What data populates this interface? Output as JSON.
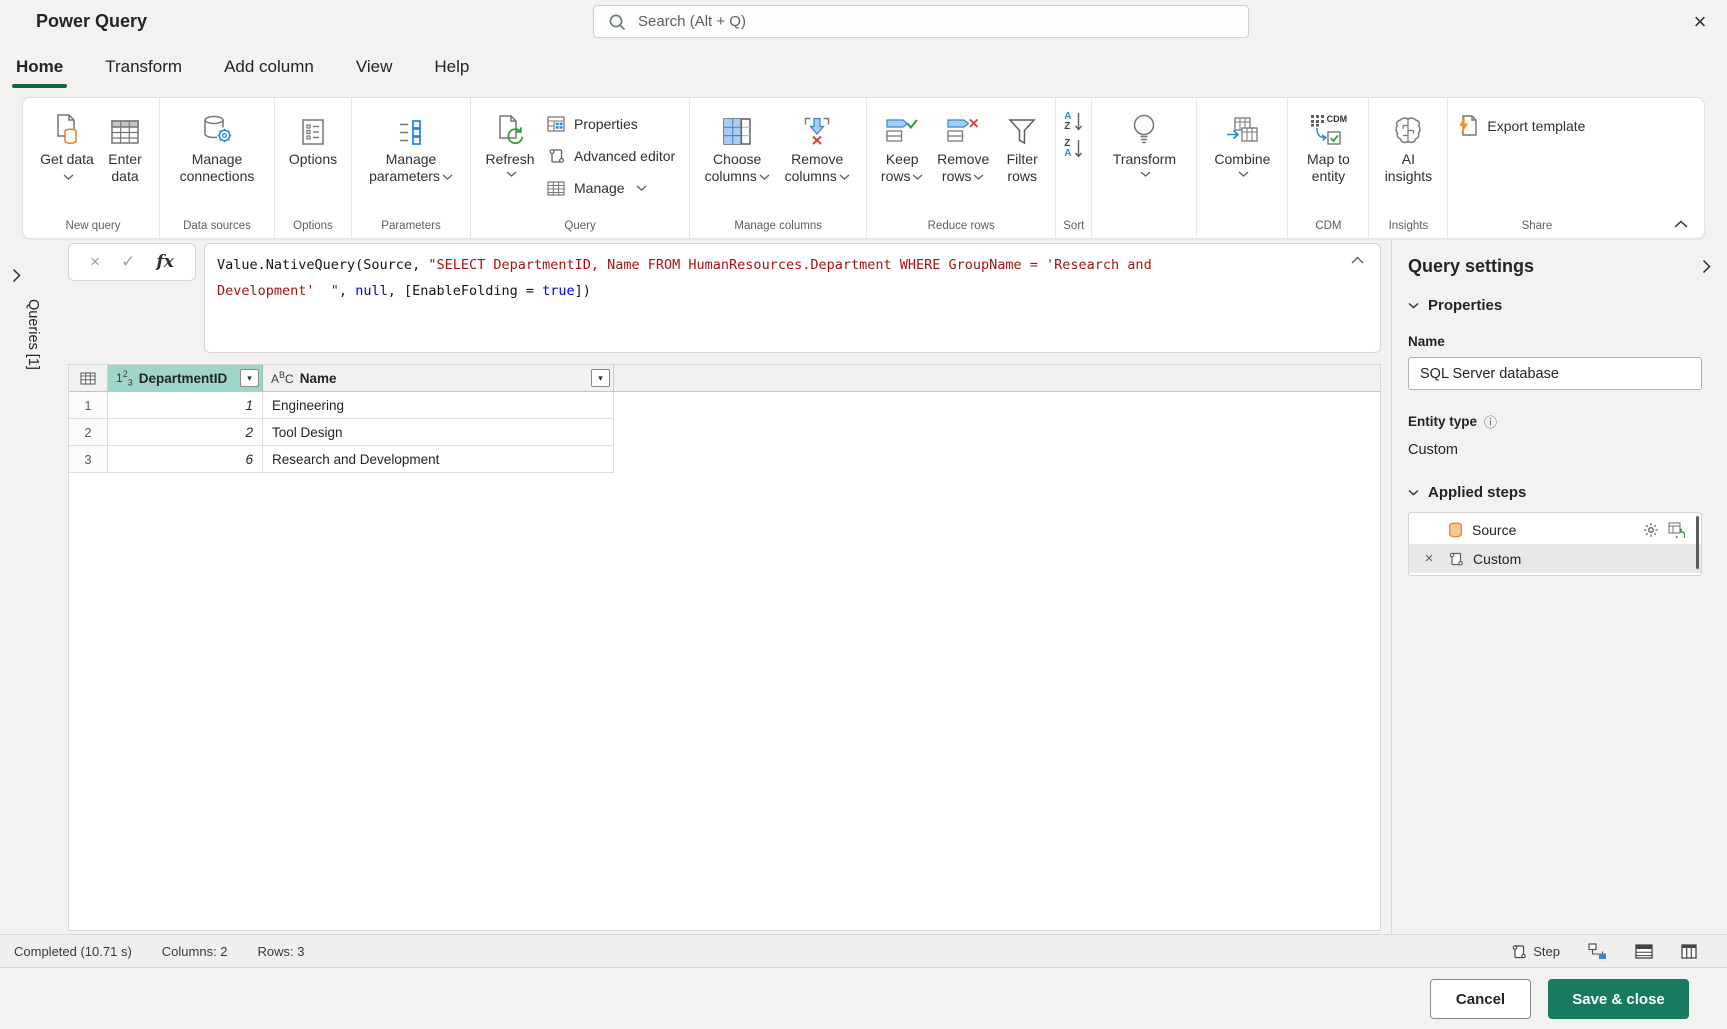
{
  "colors": {
    "accent_green": "#156640",
    "save_button": "#187a60",
    "selected_column_header": "#9fd6c9",
    "code_string": "#a31515",
    "code_keyword": "#0000d4"
  },
  "titlebar": {
    "title": "Power Query",
    "search_placeholder": "Search (Alt + Q)",
    "close_glyph": "×"
  },
  "tabs": {
    "home": "Home",
    "transform": "Transform",
    "add_column": "Add column",
    "view": "View",
    "help": "Help"
  },
  "ribbon": {
    "new_query": {
      "group": "New query",
      "get_data": "Get data",
      "enter_data": "Enter data"
    },
    "data_sources": {
      "group": "Data sources",
      "manage_connections": "Manage connections"
    },
    "options_group": {
      "group": "Options",
      "options": "Options"
    },
    "parameters": {
      "group": "Parameters",
      "manage_parameters": "Manage parameters"
    },
    "query": {
      "group": "Query",
      "refresh": "Refresh",
      "properties": "Properties",
      "advanced_editor": "Advanced editor",
      "manage": "Manage"
    },
    "manage_columns": {
      "group": "Manage columns",
      "choose_columns": "Choose columns",
      "remove_columns": "Remove columns"
    },
    "reduce_rows": {
      "group": "Reduce rows",
      "keep_rows": "Keep rows",
      "remove_rows": "Remove rows",
      "filter_rows": "Filter rows"
    },
    "sort": {
      "group": "Sort",
      "letter_a": "A",
      "letter_z": "Z"
    },
    "transform": {
      "label": "Transform"
    },
    "combine": {
      "label": "Combine"
    },
    "cdm": {
      "group": "CDM",
      "map_to_entity": "Map to entity",
      "icon_text": "CDM"
    },
    "insights": {
      "group": "Insights",
      "ai_insights": "AI insights"
    },
    "share": {
      "group": "Share",
      "export_template": "Export template"
    }
  },
  "queries_pane": {
    "label": "Queries [1]"
  },
  "formula": {
    "fx_glyph": "fx",
    "cancel_glyph": "×",
    "check_glyph": "✓",
    "line1": {
      "plain": "Value.NativeQuery(Source, ",
      "string": "\"SELECT DepartmentID, Name FROM HumanResources.Department WHERE GroupName = 'Research and"
    },
    "line2": {
      "string": "Development'  \"",
      "p1": ", ",
      "kw1": "null",
      "p2": ", [EnableFolding = ",
      "kw2": "true",
      "p3": "])"
    }
  },
  "grid": {
    "columns": [
      {
        "t_main": "1",
        "t_sup": "2",
        "t_sub": "3",
        "name": "DepartmentID",
        "dd": "▾"
      },
      {
        "t_main": "A",
        "t_sup": "B",
        "t_sub": "C",
        "name": "Name",
        "dd": "▾"
      }
    ],
    "rows": [
      {
        "num": "1",
        "id": "1",
        "name": "Engineering"
      },
      {
        "num": "2",
        "id": "2",
        "name": "Tool Design"
      },
      {
        "num": "3",
        "id": "6",
        "name": "Research and Development"
      }
    ]
  },
  "query_settings": {
    "title": "Query settings",
    "properties": "Properties",
    "name_label": "Name",
    "name_value": "SQL Server database",
    "entity_type_label": "Entity type",
    "info_glyph": "ⓘ",
    "entity_type_value": "Custom",
    "applied_steps": "Applied steps",
    "steps": [
      {
        "label": "Source"
      },
      {
        "label": "Custom",
        "delete_glyph": "×"
      }
    ]
  },
  "status_bar": {
    "completed": "Completed (10.71 s)",
    "columns": "Columns: 2",
    "rows": "Rows: 3",
    "step": "Step"
  },
  "footer": {
    "cancel": "Cancel",
    "save": "Save & close"
  }
}
